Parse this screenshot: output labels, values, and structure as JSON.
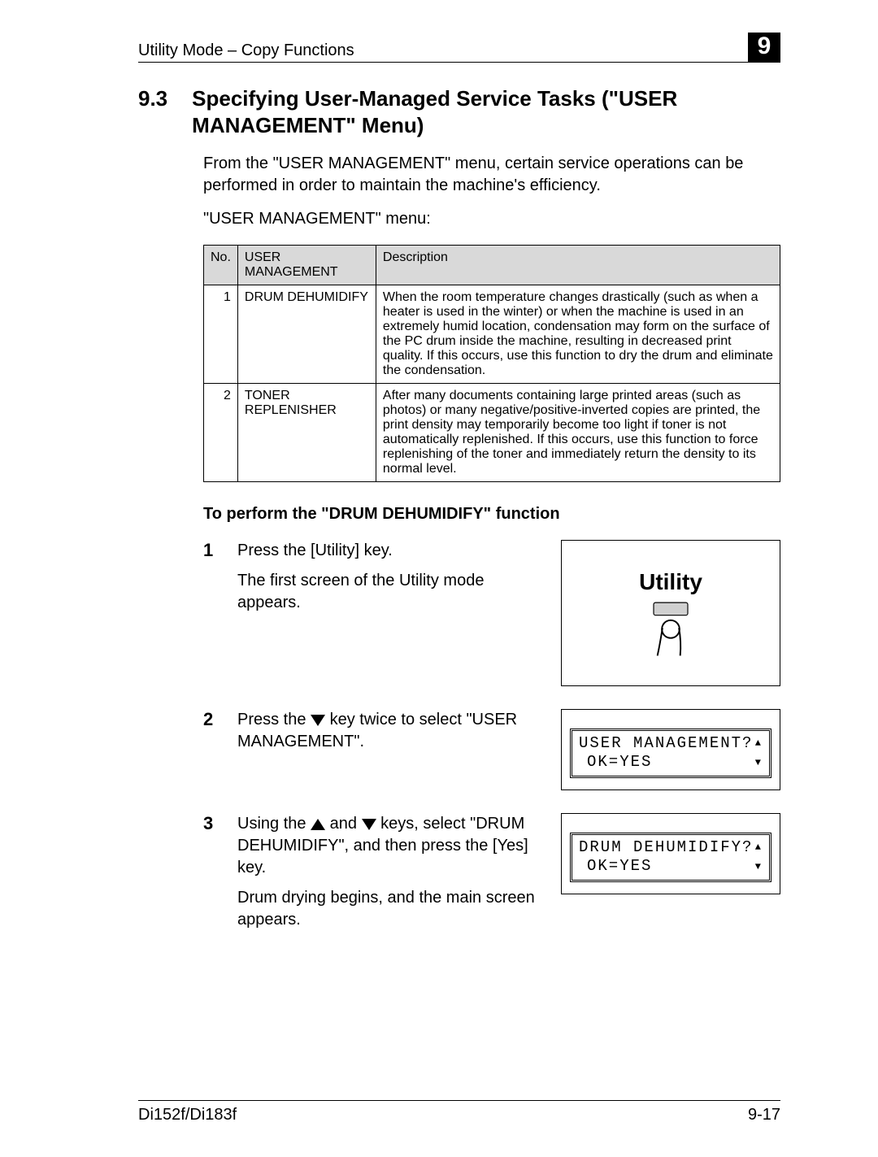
{
  "header": {
    "breadcrumb": "Utility Mode – Copy Functions",
    "chapter_number": "9"
  },
  "section": {
    "number": "9.3",
    "title": "Specifying User-Managed Service Tasks (\"USER MANAGEMENT\" Menu)"
  },
  "intro_para": "From the \"USER MANAGEMENT\" menu, certain service operations can be performed in order to maintain the machine's efficiency.",
  "menu_label": "\"USER MANAGEMENT\" menu:",
  "table": {
    "headers": {
      "no": "No.",
      "name": "USER MANAGEMENT",
      "desc": "Description"
    },
    "rows": [
      {
        "no": "1",
        "name": "DRUM DEHUMIDIFY",
        "desc": "When the room temperature changes drastically (such as when a heater is used in the winter) or when the machine is used in an extremely humid location, condensation may form on the surface of the PC drum inside the machine, resulting in decreased print quality. If this occurs, use this function to dry the drum and eliminate the condensation."
      },
      {
        "no": "2",
        "name": "TONER REPLENISHER",
        "desc": "After many documents containing large printed areas (such as photos) or many negative/positive-inverted copies are printed, the print density may temporarily become too light if toner is not automatically replenished. If this occurs, use this function to force replenishing of the toner and immediately return the density to its normal level."
      }
    ]
  },
  "procedure_title": "To perform the \"DRUM DEHUMIDIFY\" function",
  "steps": [
    {
      "num": "1",
      "line1": "Press the [Utility] key.",
      "line2": "The first screen of the Utility mode appears.",
      "figure": {
        "kind": "utility",
        "label": "Utility"
      }
    },
    {
      "num": "2",
      "line1_pre": "Press the ",
      "line1_post": " key twice to select \"USER MANAGEMENT\".",
      "figure": {
        "kind": "lcd",
        "row1": "USER MANAGEMENT?",
        "row2": "OK=YES"
      }
    },
    {
      "num": "3",
      "line1_pre": "Using the ",
      "line1_mid": " and ",
      "line1_post": " keys, select \"DRUM DEHUMIDIFY\", and then press the [Yes] key.",
      "line2": "Drum drying begins, and the main screen appears.",
      "figure": {
        "kind": "lcd",
        "row1": "DRUM DEHUMIDIFY?",
        "row2": "OK=YES"
      }
    }
  ],
  "footer": {
    "left": "Di152f/Di183f",
    "right": "9-17"
  },
  "icons": {
    "up": "▲",
    "down": "▼"
  }
}
